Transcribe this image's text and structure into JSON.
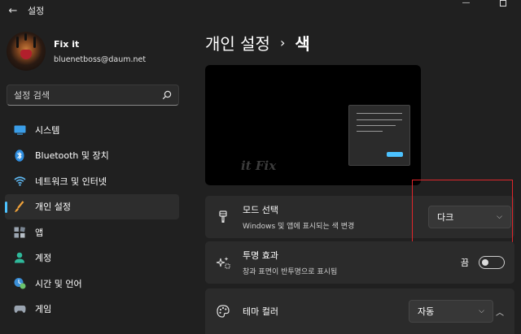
{
  "window": {
    "title": "설정",
    "back_icon": "arrow-left-icon",
    "minimize": "—",
    "maximize": "□"
  },
  "profile": {
    "name": "Fix it",
    "email": "bluenetboss@daum.net"
  },
  "search": {
    "placeholder": "설정 검색"
  },
  "sidebar": {
    "items": [
      {
        "label": "시스템",
        "icon": "system-icon",
        "active": false
      },
      {
        "label": "Bluetooth 및 장치",
        "icon": "bluetooth-icon",
        "active": false
      },
      {
        "label": "네트워크 및 인터넷",
        "icon": "wifi-icon",
        "active": false
      },
      {
        "label": "개인 설정",
        "icon": "brush-icon",
        "active": true
      },
      {
        "label": "앱",
        "icon": "apps-icon",
        "active": false
      },
      {
        "label": "계정",
        "icon": "account-icon",
        "active": false
      },
      {
        "label": "시간 및 언어",
        "icon": "clock-globe-icon",
        "active": false
      },
      {
        "label": "게임",
        "icon": "game-controller-icon",
        "active": false
      }
    ]
  },
  "main": {
    "breadcrumb_parent": "개인 설정",
    "breadcrumb_separator": "›",
    "breadcrumb_current": "색",
    "preview_watermark": "it Fix",
    "mode": {
      "title": "모드 선택",
      "subtitle": "Windows 및 앱에 표시되는 색 변경",
      "value": "다크",
      "icon": "paint-brush-icon"
    },
    "transparency": {
      "title": "투명 효과",
      "subtitle": "창과 표면이 반투명으로 표시됨",
      "state": "끔",
      "enabled": false,
      "icon": "sparkle-icon"
    },
    "accent": {
      "title": "테마 컬러",
      "value": "자동",
      "icon": "palette-icon"
    }
  },
  "colors": {
    "background": "#202020",
    "card": "#2b2b2b",
    "accent": "#4cc2ff",
    "highlight": "#e0262b"
  }
}
